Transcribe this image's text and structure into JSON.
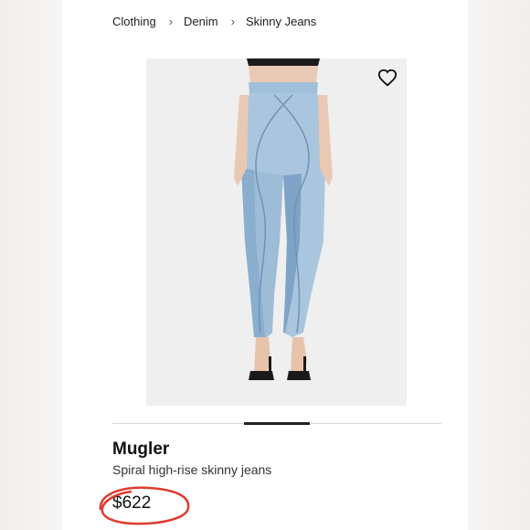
{
  "breadcrumb": [
    "Clothing",
    "Denim",
    "Skinny Jeans"
  ],
  "product": {
    "brand": "Mugler",
    "name": "Spiral high-rise skinny jeans",
    "price": "$622"
  },
  "icons": {
    "favorite": "heart-outline-icon",
    "separator": "chevron-right-icon"
  },
  "colors": {
    "denim_light": "#a9c6de",
    "denim_mid": "#8fb1d0",
    "annotation_red": "#e03b2f",
    "image_bg": "#efefef"
  }
}
